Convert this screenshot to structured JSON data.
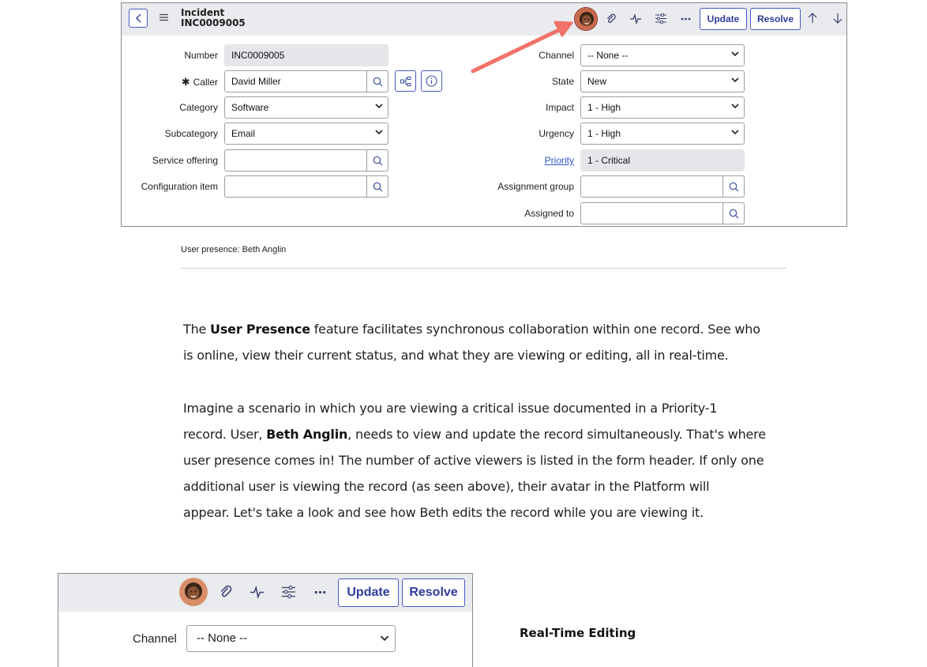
{
  "form": {
    "title": "Incident",
    "number_header": "INC0009005",
    "actions": {
      "update": "Update",
      "resolve": "Resolve"
    },
    "left": {
      "number": {
        "label": "Number",
        "value": "INC0009005"
      },
      "caller": {
        "label": "Caller",
        "required_marker": "✱",
        "value": "David Miller"
      },
      "category": {
        "label": "Category",
        "value": "Software"
      },
      "subcategory": {
        "label": "Subcategory",
        "value": "Email"
      },
      "service_offering": {
        "label": "Service offering",
        "value": ""
      },
      "configuration_item": {
        "label": "Configuration item",
        "value": ""
      }
    },
    "right": {
      "channel": {
        "label": "Channel",
        "value": "-- None --"
      },
      "state": {
        "label": "State",
        "value": "New"
      },
      "impact": {
        "label": "Impact",
        "value": "1 - High"
      },
      "urgency": {
        "label": "Urgency",
        "value": "1 - High"
      },
      "priority": {
        "label": "Priority",
        "value": "1 - Critical"
      },
      "assignment_group": {
        "label": "Assignment group",
        "value": ""
      },
      "assigned_to": {
        "label": "Assigned to",
        "value": ""
      }
    }
  },
  "caption": "User presence: Beth Anglin",
  "paragraph1": {
    "pre": "The ",
    "bold": "User Presence",
    "line1_rest": " feature facilitates synchronous collaboration within one record. See who",
    "line2": "is online, view their current status, and what they are viewing or editing, all in real-time."
  },
  "paragraph2": {
    "line1": "Imagine a scenario in which you are viewing a critical issue documented in a Priority-1",
    "line2_pre": "record. User, ",
    "line2_bold": "Beth Anglin",
    "line2_rest": ", needs to view and update the record simultaneously. That's where",
    "line3": "user presence comes in! The number of active viewers is listed in the form header. If only one",
    "line4": "additional user is viewing the record (as seen above), their avatar in the Platform will",
    "line5": "appear. Let's take a look and see how Beth edits the record while you are viewing it."
  },
  "zoom_form": {
    "actions": {
      "update": "Update",
      "resolve": "Resolve"
    },
    "channel": {
      "label": "Channel",
      "value": "-- None --"
    }
  },
  "section_heading": "Real-Time Editing",
  "colors": {
    "accent": "#4a5bc4",
    "header_bg": "#e9ebee",
    "annotation_arrow": "#f07268"
  },
  "icons": [
    "back-icon",
    "hamburger-menu-icon",
    "user-avatar",
    "paperclip-icon",
    "activity-icon",
    "settings-sliders-icon",
    "more-icon",
    "arrow-up-icon",
    "arrow-down-icon",
    "search-icon",
    "dependency-icon",
    "info-icon",
    "chevron-down-icon"
  ]
}
